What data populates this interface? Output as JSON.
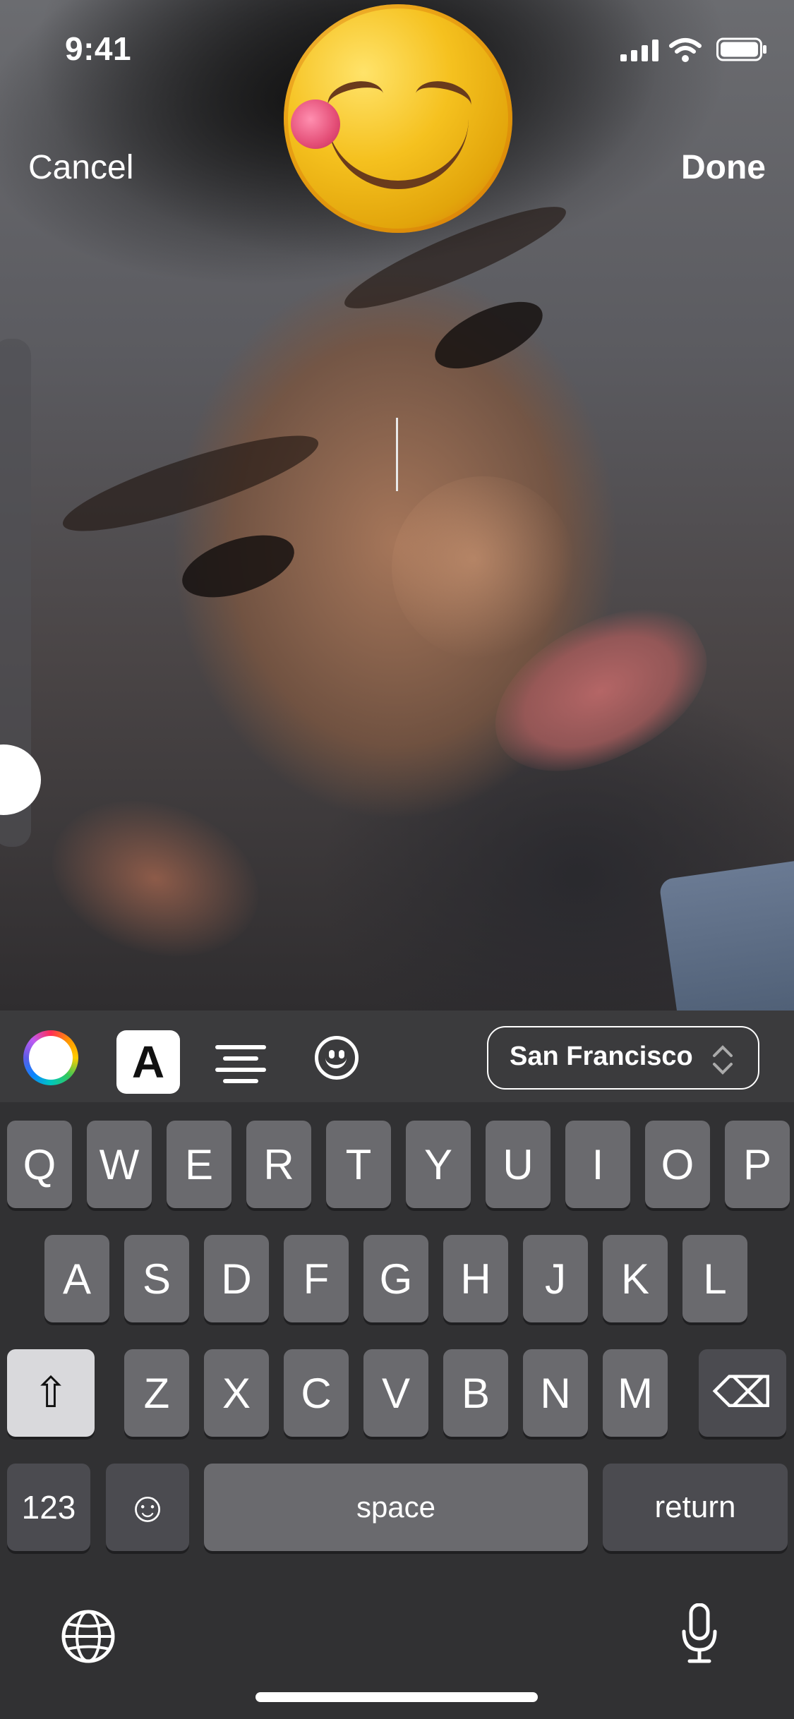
{
  "status_bar": {
    "time": "9:41"
  },
  "top_bar": {
    "cancel_label": "Cancel",
    "done_label": "Done"
  },
  "toolbar": {
    "text_style_label": "A",
    "font_label": "San Francisco"
  },
  "keyboard": {
    "rows": [
      [
        "Q",
        "W",
        "E",
        "R",
        "T",
        "Y",
        "U",
        "I",
        "O",
        "P"
      ],
      [
        "A",
        "S",
        "D",
        "F",
        "G",
        "H",
        "J",
        "K",
        "L"
      ],
      [
        "Z",
        "X",
        "C",
        "V",
        "B",
        "N",
        "M"
      ]
    ],
    "shift_symbol": "⇧",
    "delete_symbol": "⌫",
    "numbers_label": "123",
    "emoji_symbol": "☺",
    "space_label": "space",
    "return_label": "return"
  },
  "colors": {
    "keyboard_bg": "#313133",
    "toolbar_bg": "#3b3b3d",
    "key_bg": "#6a6a6e",
    "emoji_yellow": "#f5c11f"
  },
  "icons": {
    "emoji_sticker": "face-savoring-food-icon",
    "color_picker": "color-wheel-icon",
    "align": "align-center-icon",
    "sticker": "smiley-icon",
    "globe": "globe-icon",
    "mic": "microphone-icon"
  }
}
